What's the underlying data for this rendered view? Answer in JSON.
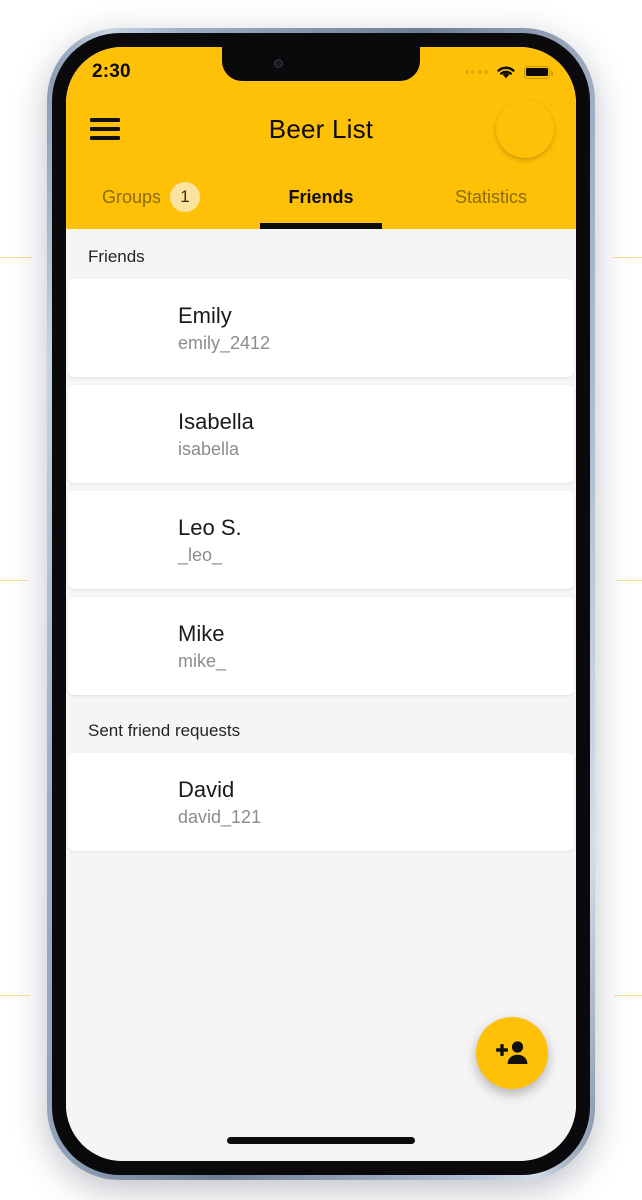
{
  "status_bar": {
    "time": "2:30",
    "signal_icon": "signal-dots-icon",
    "wifi_icon": "wifi-icon",
    "battery_icon": "battery-full-icon"
  },
  "app_bar": {
    "menu_icon": "hamburger-menu-icon",
    "title": "Beer List",
    "avatar_name": "user-profile-avatar"
  },
  "tabs": [
    {
      "label": "Groups",
      "badge": "1",
      "active": false
    },
    {
      "label": "Friends",
      "badge": "",
      "active": true
    },
    {
      "label": "Statistics",
      "badge": "",
      "active": false
    }
  ],
  "sections": [
    {
      "header": "Friends",
      "rows": [
        {
          "name": "Emily",
          "handle": "emily_2412",
          "avatar": "emily-avatar"
        },
        {
          "name": "Isabella",
          "handle": "isabella",
          "avatar": "isabella-avatar"
        },
        {
          "name": "Leo S.",
          "handle": "_leo_",
          "avatar": "leo-avatar"
        },
        {
          "name": "Mike",
          "handle": "mike_",
          "avatar": "mike-avatar"
        }
      ]
    },
    {
      "header": "Sent friend requests",
      "rows": [
        {
          "name": "David",
          "handle": "david_121",
          "avatar": "david-avatar"
        }
      ]
    }
  ],
  "fab": {
    "icon": "person-add-icon",
    "label": "Add friend"
  },
  "colors": {
    "accent": "#FFC107",
    "badge_bg": "#FBE3A0",
    "tab_inactive": "#8A6D09",
    "tab_active": "#0B0B0B",
    "content_bg": "#F5F5F5",
    "card_bg": "#FFFFFF",
    "name_text": "#1A1A1A",
    "handle_text": "#8C8C8C"
  },
  "home_indicator": "home-indicator"
}
